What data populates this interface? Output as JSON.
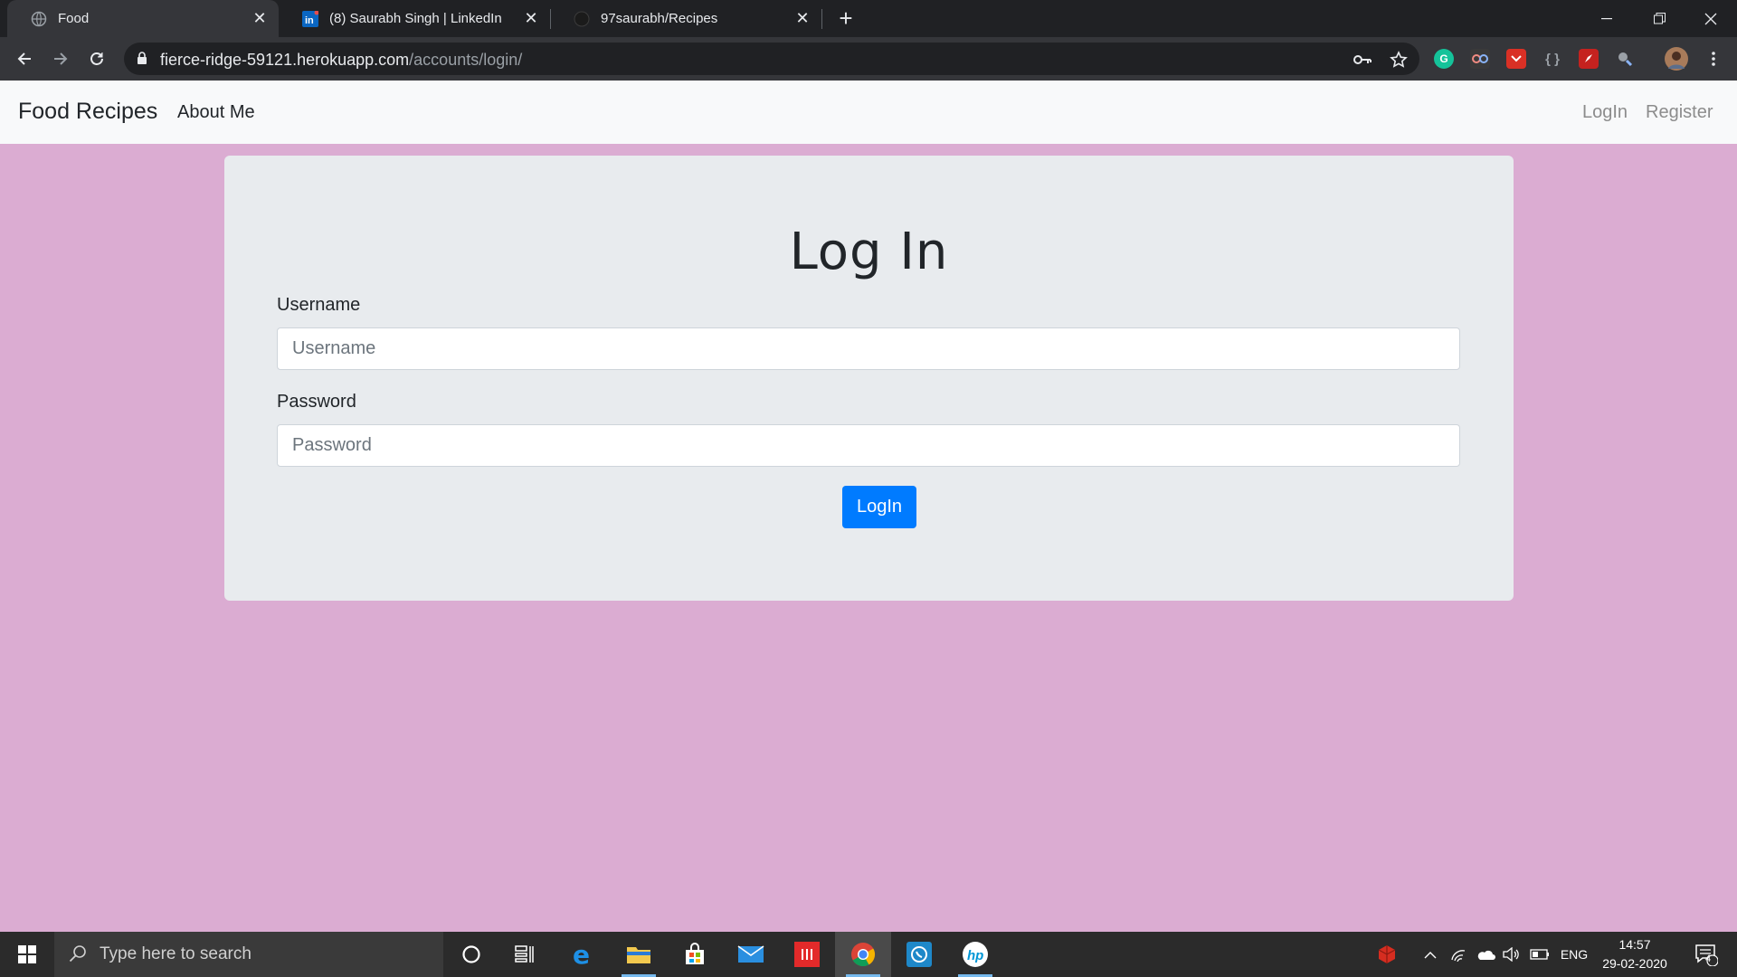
{
  "browser": {
    "tabs": [
      {
        "title": "Food",
        "icon": "globe-icon"
      },
      {
        "title": "(8) Saurabh Singh | LinkedIn",
        "icon": "linkedin-icon"
      },
      {
        "title": "97saurabh/Recipes",
        "icon": "github-icon"
      }
    ],
    "url": {
      "host": "fierce-ridge-59121.herokuapp.com",
      "path": "/accounts/login/"
    }
  },
  "site": {
    "brand": "Food Recipes",
    "nav": {
      "about": "About Me",
      "login": "LogIn",
      "register": "Register"
    }
  },
  "form": {
    "heading": "Log In",
    "username_label": "Username",
    "username_placeholder": "Username",
    "password_label": "Password",
    "password_placeholder": "Password",
    "submit_label": "LogIn"
  },
  "taskbar": {
    "search_placeholder": "Type here to search",
    "language": "ENG",
    "time": "14:57",
    "date": "29-02-2020",
    "notification_count": "4"
  },
  "colors": {
    "page_bg": "#dbacd2",
    "card_bg": "#e8ebee",
    "primary": "#007bff"
  }
}
